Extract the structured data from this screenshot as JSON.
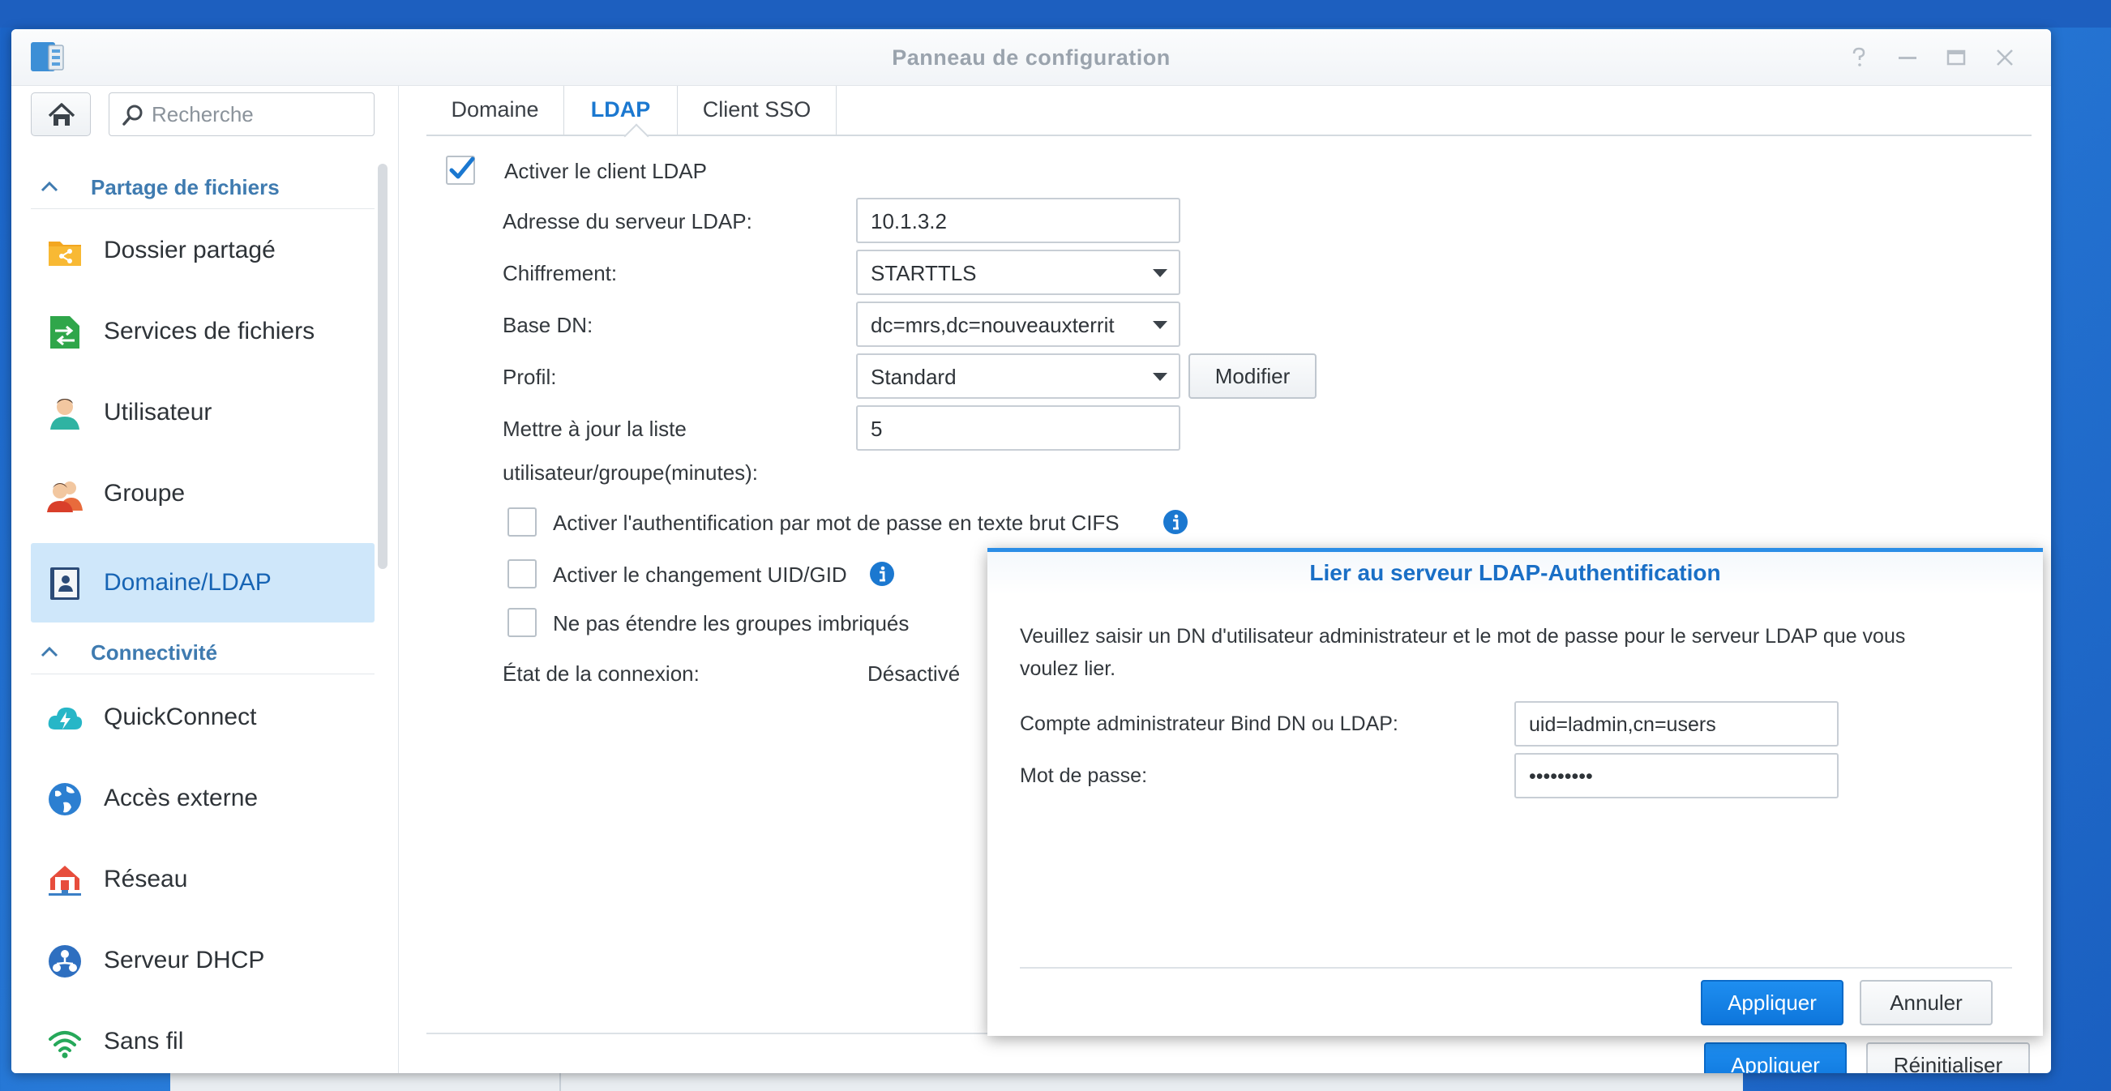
{
  "window": {
    "title": "Panneau de configuration"
  },
  "sidebar": {
    "search_placeholder": "Recherche",
    "sections": [
      {
        "label": "Partage de fichiers"
      },
      {
        "label": "Connectivité"
      }
    ],
    "items": [
      {
        "label": "Dossier partagé",
        "icon": "shared-folder-icon"
      },
      {
        "label": "Services de fichiers",
        "icon": "file-services-icon"
      },
      {
        "label": "Utilisateur",
        "icon": "user-icon"
      },
      {
        "label": "Groupe",
        "icon": "group-icon"
      },
      {
        "label": "Domaine/LDAP",
        "icon": "domain-ldap-icon",
        "active": true
      },
      {
        "label": "QuickConnect",
        "icon": "quickconnect-icon"
      },
      {
        "label": "Accès externe",
        "icon": "external-access-icon"
      },
      {
        "label": "Réseau",
        "icon": "network-icon"
      },
      {
        "label": "Serveur DHCP",
        "icon": "dhcp-server-icon"
      },
      {
        "label": "Sans fil",
        "icon": "wireless-icon"
      }
    ]
  },
  "tabs": [
    {
      "label": "Domaine"
    },
    {
      "label": "LDAP",
      "active": true
    },
    {
      "label": "Client SSO"
    }
  ],
  "ldap": {
    "enable_label": "Activer le client LDAP",
    "enable_checked": true,
    "server_label": "Adresse du serveur LDAP:",
    "server_value": "10.1.3.2",
    "encryption_label": "Chiffrement:",
    "encryption_value": "STARTTLS",
    "base_dn_label": "Base DN:",
    "base_dn_value": "dc=mrs,dc=nouveauxterrit",
    "profile_label": "Profil:",
    "profile_value": "Standard",
    "modify_button": "Modifier",
    "update_label_line1": "Mettre à jour la liste",
    "update_label_line2": "utilisateur/groupe(minutes):",
    "update_value": "5",
    "cifs_label": "Activer l'authentification par mot de passe en texte brut CIFS",
    "uid_gid_label": "Activer le changement UID/GID",
    "nested_label": "Ne pas étendre les groupes imbriqués",
    "status_label": "État de la connexion:",
    "status_value": "Désactivé"
  },
  "footer": {
    "apply_button": "Appliquer",
    "reset_button": "Réinitialiser"
  },
  "dialog": {
    "title": "Lier au serveur LDAP-Authentification",
    "desc_line1": "Veuillez saisir un DN d'utilisateur administrateur et le mot de passe pour le serveur LDAP que vous",
    "desc_line2": "voulez lier.",
    "bind_dn_label": "Compte administrateur Bind DN ou LDAP:",
    "bind_dn_value": "uid=ladmin,cn=users",
    "password_label": "Mot de passe:",
    "password_value": "•••••••••",
    "apply_button": "Appliquer",
    "cancel_button": "Annuler"
  },
  "colors": {
    "accent": "#1b78d0",
    "active_bg": "#cfe7fa",
    "primary_button": "#0e76dc"
  }
}
